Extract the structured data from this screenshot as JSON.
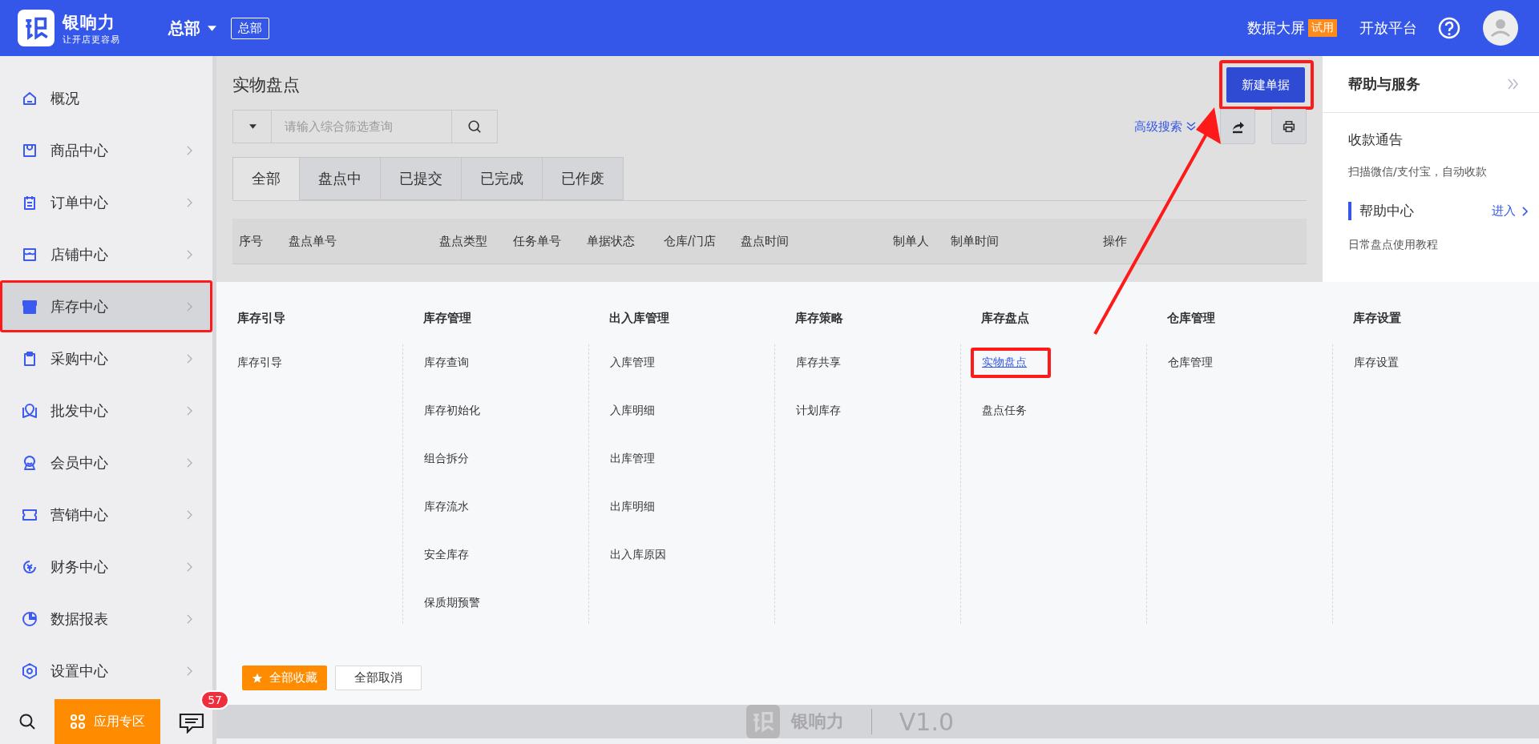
{
  "header": {
    "brand": "银响力",
    "slogan": "让开店更容易",
    "store": "总部",
    "store_tag": "总部",
    "links": [
      {
        "label": "数据大屏",
        "badge": "试用"
      },
      {
        "label": "开放平台"
      }
    ]
  },
  "sidebar": {
    "items": [
      {
        "label": "概况",
        "selected": false,
        "expandable": false,
        "highlighted": false
      },
      {
        "label": "商品中心",
        "selected": false,
        "expandable": true,
        "highlighted": false
      },
      {
        "label": "订单中心",
        "selected": false,
        "expandable": true,
        "highlighted": false
      },
      {
        "label": "店铺中心",
        "selected": false,
        "expandable": true,
        "highlighted": false
      },
      {
        "label": "库存中心",
        "selected": true,
        "expandable": true,
        "highlighted": true
      },
      {
        "label": "采购中心",
        "selected": false,
        "expandable": true,
        "highlighted": false
      },
      {
        "label": "批发中心",
        "selected": false,
        "expandable": true,
        "highlighted": false
      },
      {
        "label": "会员中心",
        "selected": false,
        "expandable": true,
        "highlighted": false
      },
      {
        "label": "营销中心",
        "selected": false,
        "expandable": true,
        "highlighted": false
      },
      {
        "label": "财务中心",
        "selected": false,
        "expandable": true,
        "highlighted": false
      },
      {
        "label": "数据报表",
        "selected": false,
        "expandable": true,
        "highlighted": false
      },
      {
        "label": "设置中心",
        "selected": false,
        "expandable": true,
        "highlighted": false
      }
    ],
    "apps_button": "应用专区",
    "message_badge": "57"
  },
  "page": {
    "title": "实物盘点",
    "new_button": {
      "label": "新建单据",
      "highlighted": true
    },
    "search": {
      "placeholder": "请输入综合筛选查询"
    },
    "advanced_search": "高级搜索",
    "tabs": [
      {
        "label": "全部",
        "selected": true
      },
      {
        "label": "盘点中",
        "selected": false
      },
      {
        "label": "已提交",
        "selected": false
      },
      {
        "label": "已完成",
        "selected": false
      },
      {
        "label": "已作废",
        "selected": false
      }
    ],
    "table": {
      "columns": [
        "序号",
        "盘点单号",
        "盘点类型",
        "任务单号",
        "单据状态",
        "仓库/门店",
        "盘点时间",
        "制单人",
        "制单时间",
        "操作"
      ]
    }
  },
  "menu": {
    "columns": [
      {
        "title": "库存引导",
        "items": [
          {
            "label": "库存引导",
            "selected": false,
            "highlighted": false
          }
        ]
      },
      {
        "title": "库存管理",
        "items": [
          {
            "label": "库存查询",
            "selected": false,
            "highlighted": false
          },
          {
            "label": "库存初始化",
            "selected": false,
            "highlighted": false
          },
          {
            "label": "组合拆分",
            "selected": false,
            "highlighted": false
          },
          {
            "label": "库存流水",
            "selected": false,
            "highlighted": false
          },
          {
            "label": "安全库存",
            "selected": false,
            "highlighted": false
          },
          {
            "label": "保质期预警",
            "selected": false,
            "highlighted": false
          }
        ]
      },
      {
        "title": "出入库管理",
        "items": [
          {
            "label": "入库管理",
            "selected": false,
            "highlighted": false
          },
          {
            "label": "入库明细",
            "selected": false,
            "highlighted": false
          },
          {
            "label": "出库管理",
            "selected": false,
            "highlighted": false
          },
          {
            "label": "出库明细",
            "selected": false,
            "highlighted": false
          },
          {
            "label": "出入库原因",
            "selected": false,
            "highlighted": false
          }
        ]
      },
      {
        "title": "库存策略",
        "items": [
          {
            "label": "库存共享",
            "selected": false,
            "highlighted": false
          },
          {
            "label": "计划库存",
            "selected": false,
            "highlighted": false
          }
        ]
      },
      {
        "title": "库存盘点",
        "items": [
          {
            "label": "实物盘点",
            "selected": true,
            "highlighted": true
          },
          {
            "label": "盘点任务",
            "selected": false,
            "highlighted": false
          }
        ]
      },
      {
        "title": "仓库管理",
        "items": [
          {
            "label": "仓库管理",
            "selected": false,
            "highlighted": false
          }
        ]
      },
      {
        "title": "库存设置",
        "items": [
          {
            "label": "库存设置",
            "selected": false,
            "highlighted": false
          }
        ]
      }
    ],
    "buttons": [
      "全部收藏",
      "全部取消"
    ]
  },
  "help_panel": {
    "title": "帮助与服务",
    "notice_title": "收款通告",
    "notice_text": "扫描微信/支付宝，自动收款",
    "section": "帮助中心",
    "enter_link": "进入",
    "items": [
      "日常盘点使用教程"
    ]
  },
  "footer": {
    "brand": "银响力",
    "version": "V1.0"
  }
}
